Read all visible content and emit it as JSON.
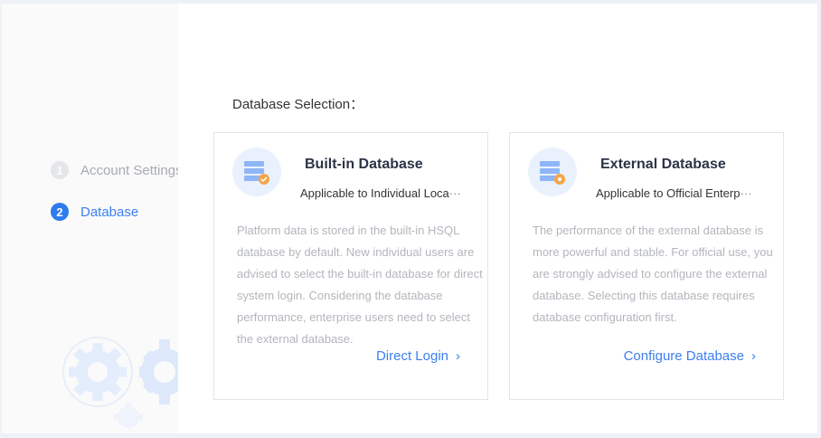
{
  "steps": [
    {
      "num": "1",
      "label": "Account Settings"
    },
    {
      "num": "2",
      "label": "Database"
    }
  ],
  "main": {
    "title": "Database Selection：",
    "cards": [
      {
        "title": "Built-in Database",
        "subtitle": "Applicable to Individual Loca",
        "ellipsis": "···",
        "description": "Platform data is stored in the built-in HSQL database by default. New individual users are advised to select the built-in database for direct system login. Considering the database performance, enterprise users need to select the external database.",
        "link": "Direct Login"
      },
      {
        "title": "External Database",
        "subtitle": "Applicable to Official Enterp",
        "ellipsis": "···",
        "description": "The performance of the external database is more powerful and stable. For official use, you are strongly advised to configure the external database. Selecting this database requires database configuration first.",
        "link": "Configure Database"
      }
    ]
  },
  "colors": {
    "accent": "#3d7ff0",
    "badge_orange": "#f5a54a"
  }
}
